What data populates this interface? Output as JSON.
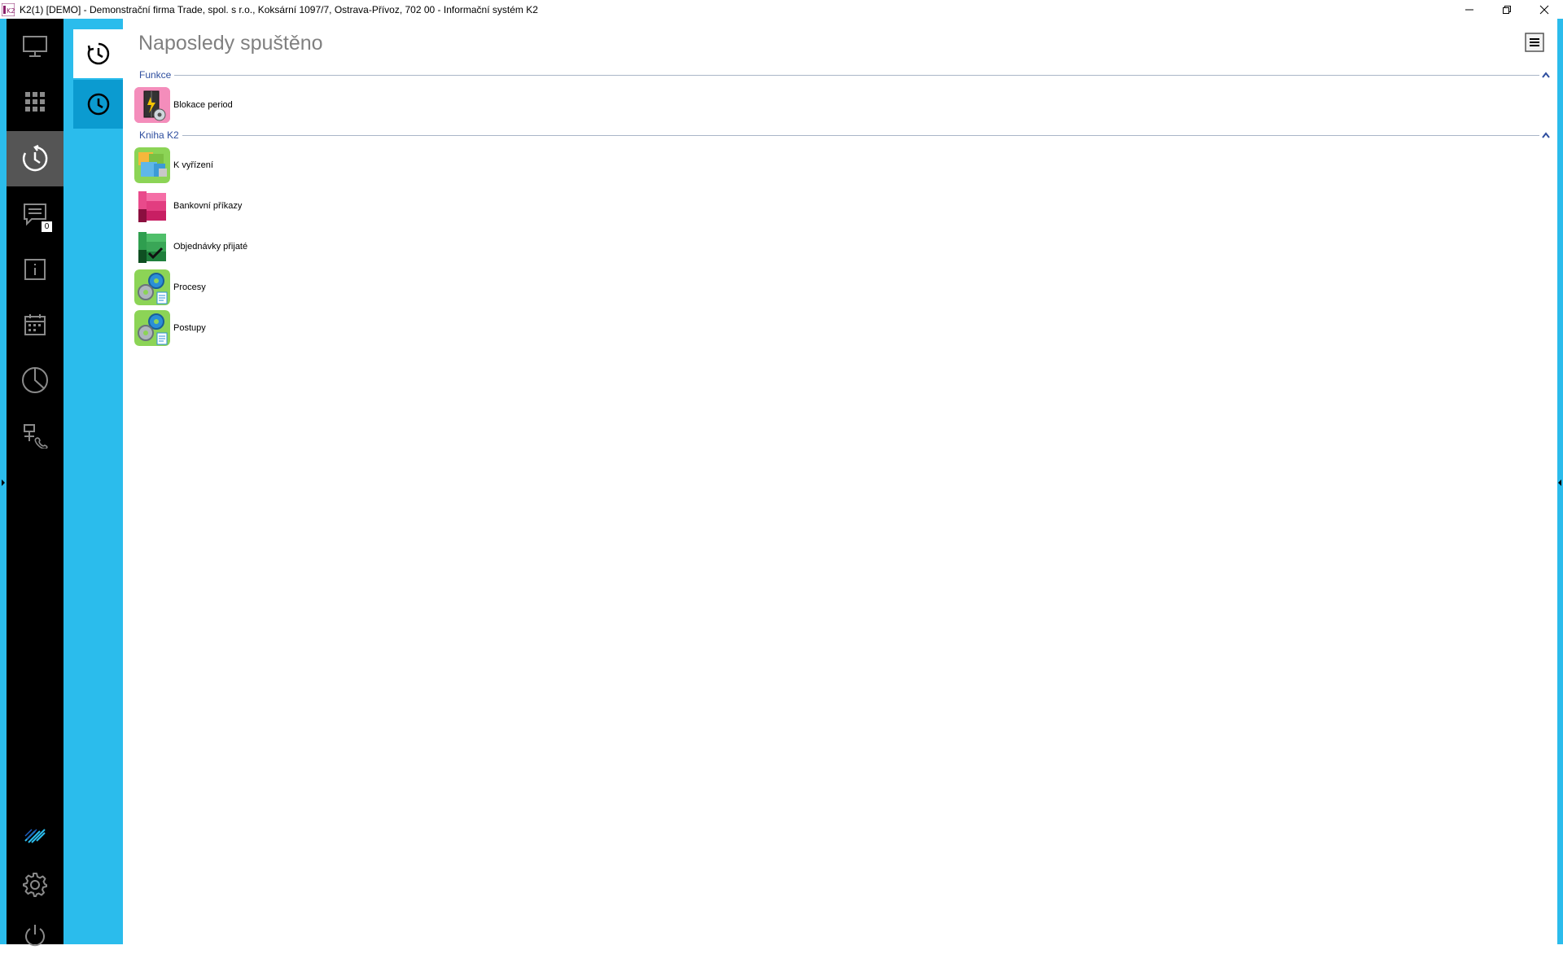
{
  "window": {
    "title": "K2(1) [DEMO] - Demonstrační firma Trade, spol. s r.o., Koksární 1097/7, Ostrava-Přívoz, 702 00 - Informační systém K2"
  },
  "sidebar": {
    "items": [
      {
        "icon": "monitor-icon"
      },
      {
        "icon": "apps-grid-icon"
      },
      {
        "icon": "history-icon",
        "active": true
      },
      {
        "icon": "messages-icon",
        "badge": "0"
      },
      {
        "icon": "info-icon"
      },
      {
        "icon": "calendar-icon"
      },
      {
        "icon": "pie-chart-icon"
      },
      {
        "icon": "network-phone-icon"
      }
    ],
    "bottom": [
      {
        "icon": "k2-logo-icon"
      },
      {
        "icon": "gear-icon"
      },
      {
        "icon": "power-icon"
      }
    ]
  },
  "main": {
    "title": "Naposledy spuštěno",
    "groups": [
      {
        "label": "Funkce",
        "items": [
          {
            "label": "Blokace period",
            "icon": "blokace-period-icon"
          }
        ]
      },
      {
        "label": "Kniha K2",
        "items": [
          {
            "label": "K vyřízení",
            "icon": "k-vyrizeni-icon"
          },
          {
            "label": "Bankovní příkazy",
            "icon": "bankovni-prikazy-icon"
          },
          {
            "label": "Objednávky přijaté",
            "icon": "objednavky-prijate-icon"
          },
          {
            "label": "Procesy",
            "icon": "procesy-icon"
          },
          {
            "label": "Postupy",
            "icon": "postupy-icon"
          }
        ]
      }
    ]
  },
  "colors": {
    "accent": "#2bbcec",
    "sidebar": "#000000",
    "group_label": "#2f4f9f"
  }
}
